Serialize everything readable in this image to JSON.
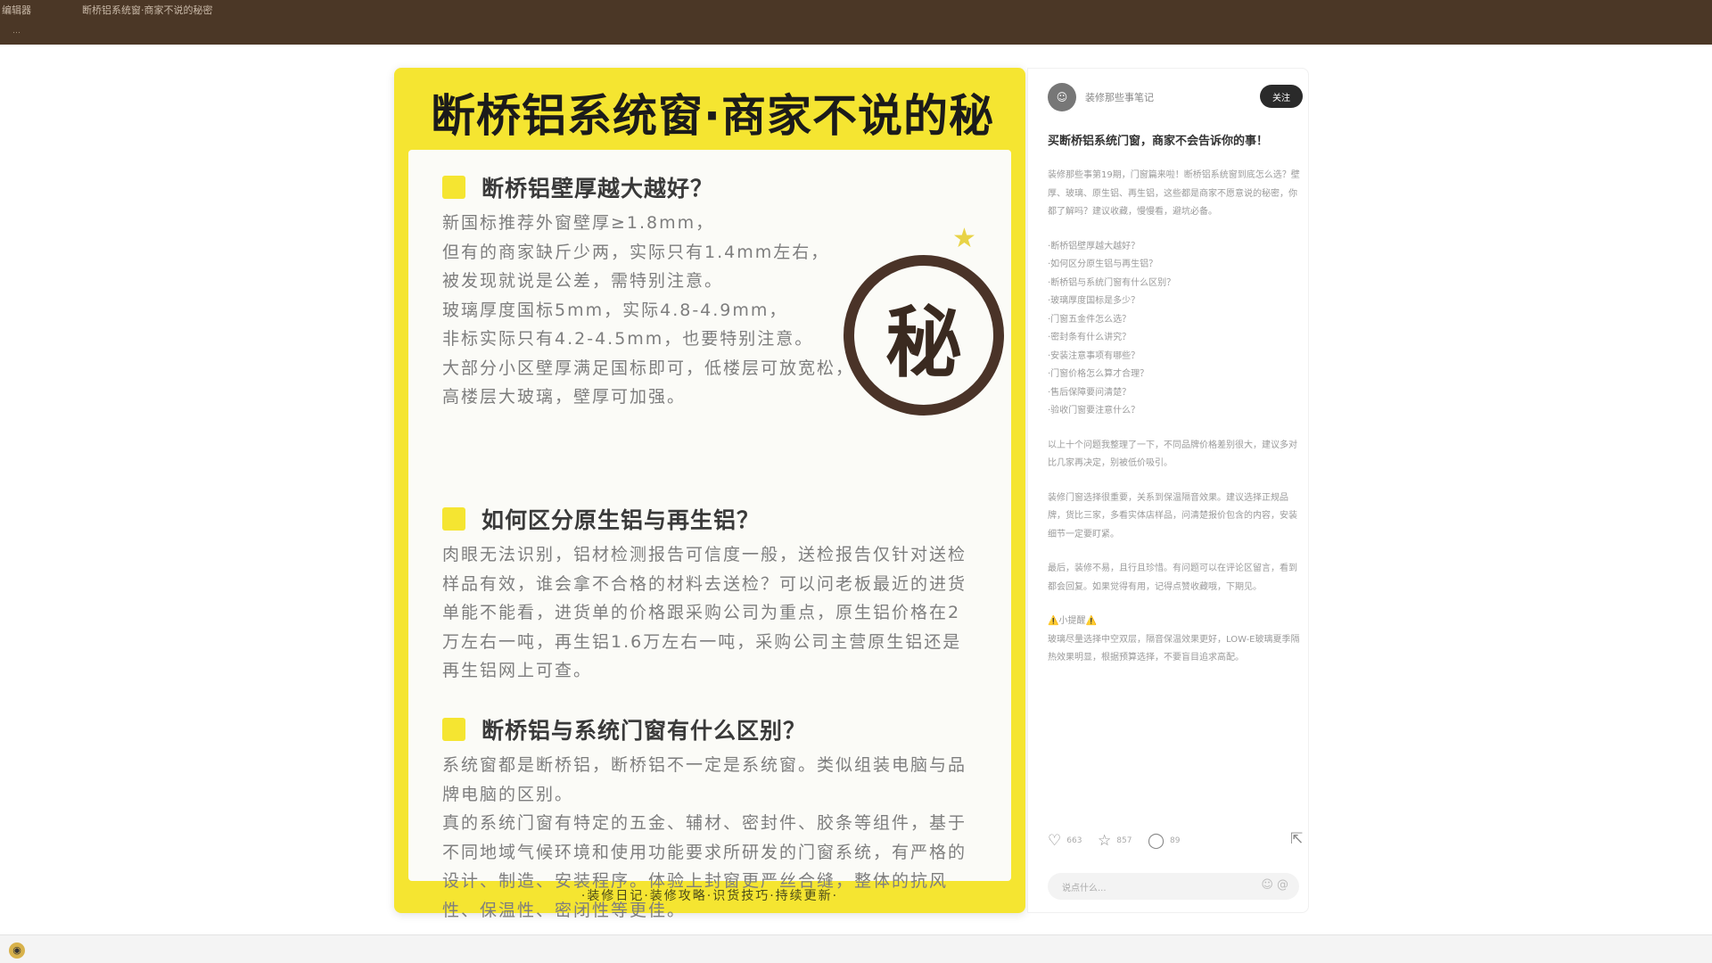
{
  "browser": {
    "tab_1": "编辑器",
    "tab_2": "断桥铝系统窗·商家不说的秘密",
    "url_hint": "…",
    "bottom_icon": "app-icon"
  },
  "card": {
    "title": "断桥铝系统窗·商家不说的秘密",
    "seal_char": "秘",
    "sections": [
      {
        "title": "断桥铝壁厚越大越好？",
        "body": "新国标推荐外窗壁厚≥1.8mm，\n但有的商家缺斤少两，实际只有1.4mm左右，\n被发现就说是公差，需特别注意。\n玻璃厚度国标5mm，实际4.8-4.9mm，\n非标实际只有4.2-4.5mm，也要特别注意。\n大部分小区壁厚满足国标即可，低楼层可放宽松，高楼层大玻璃，壁厚可加强。"
      },
      {
        "title": "如何区分原生铝与再生铝？",
        "body": "肉眼无法识别，铝材检测报告可信度一般，送检报告仅针对送检样品有效，谁会拿不合格的材料去送检？可以问老板最近的进货单能不能看，进货单的价格跟采购公司为重点，原生铝价格在2万左右一吨，再生铝1.6万左右一吨，采购公司主营原生铝还是再生铝网上可查。"
      },
      {
        "title": "断桥铝与系统门窗有什么区别？",
        "body": "系统窗都是断桥铝，断桥铝不一定是系统窗。类似组装电脑与品牌电脑的区别。\n真的系统门窗有特定的五金、辅材、密封件、胶条等组件，基于不同地域气候环境和使用功能要求所研发的门窗系统，有严格的设计、制造、安装程序。体验上封窗更严丝合缝，整体的抗风性、保温性、密闭性等更佳。"
      }
    ],
    "footer": "·装修日记·装修攻略·识货技巧·持续更新·"
  },
  "side": {
    "author": "装修那些事笔记",
    "follow_label": "关注",
    "post_title": "买断桥铝系统门窗，商家不会告诉你的事！",
    "paragraphs": [
      "装修那些事第19期，门窗篇来啦！断桥铝系统窗到底怎么选？壁厚、玻璃、原生铝、再生铝，这些都是商家不愿意说的秘密，你都了解吗？建议收藏，慢慢看，避坑必备。",
      "·断桥铝壁厚越大越好？\n·如何区分原生铝与再生铝？\n·断桥铝与系统门窗有什么区别？\n·玻璃厚度国标是多少？\n·门窗五金件怎么选？\n·密封条有什么讲究？\n·安装注意事项有哪些？\n·门窗价格怎么算才合理？\n·售后保障要问清楚？\n·验收门窗要注意什么？",
      "以上十个问题我整理了一下，不同品牌价格差别很大，建议多对比几家再决定，别被低价吸引。",
      "装修门窗选择很重要，关系到保温隔音效果。建议选择正规品牌，货比三家，多看实体店样品，问清楚报价包含的内容，安装细节一定要盯紧。",
      "最后，装修不易，且行且珍惜。有问题可以在评论区留言，看到都会回复。如果觉得有用，记得点赞收藏哦，下期见。",
      "⚠️小提醒⚠️\n玻璃尽量选择中空双层，隔音保温效果更好，LOW-E玻璃夏季隔热效果明显，根据预算选择，不要盲目追求高配。"
    ],
    "likes": "663",
    "collects": "857",
    "comments": "89",
    "comment_placeholder": "说点什么..."
  }
}
